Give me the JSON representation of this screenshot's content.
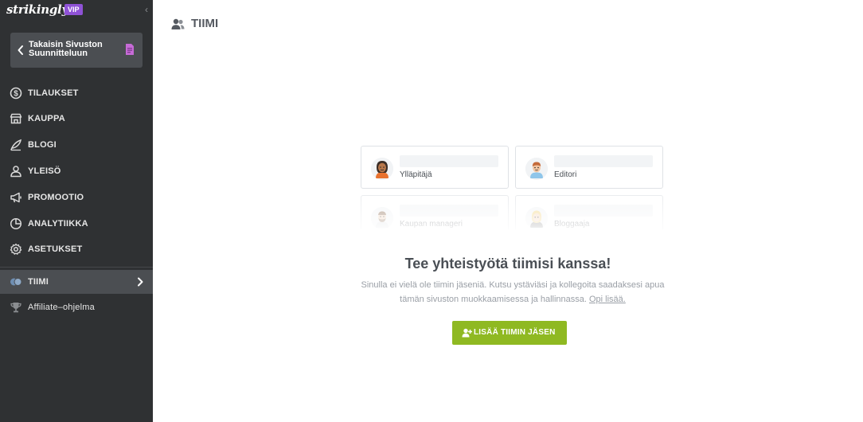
{
  "brand": {
    "logo": "strikingly",
    "badge": "VIP",
    "collapse_icon": "chevron-left-icon"
  },
  "sidebar": {
    "back_button": {
      "label": "Takaisin Sivuston Suunnitteluun",
      "icon": "chevron-left-icon",
      "file_icon": "document-icon",
      "file_icon_color": "#c66bd6"
    },
    "items": [
      {
        "label": "TILAUKSET",
        "icon": "dollar-circle-icon"
      },
      {
        "label": "KAUPPA",
        "icon": "store-icon"
      },
      {
        "label": "BLOGI",
        "icon": "quill-icon"
      },
      {
        "label": "YLEISÖ",
        "icon": "audience-icon"
      },
      {
        "label": "PROMOOTIO",
        "icon": "megaphone-icon"
      },
      {
        "label": "ANALYTIIKKA",
        "icon": "pie-chart-icon"
      },
      {
        "label": "ASETUKSET",
        "icon": "gear-icon"
      },
      {
        "label": "TIIMI",
        "icon": "team-icon",
        "active": true
      },
      {
        "label": "Affiliate–ohjelma",
        "icon": "trophy-icon"
      }
    ]
  },
  "main": {
    "title": "TIIMI",
    "title_icon": "team-icon",
    "roles": [
      "Ylläpitäjä",
      "Editori",
      "Kaupan manageri",
      "Bloggaaja"
    ],
    "headline": "Tee yhteistyötä tiimisi kanssa!",
    "description": "Sinulla ei vielä ole tiimin jäseniä. Kutsu ystäviäsi ja kollegoita saadaksesi apua tämän sivuston muokkaamisessa ja hallinnassa.",
    "learn_more": "Opi lisää.",
    "add_button": {
      "label": "LISÄÄ TIIMIN JÄSEN",
      "icon": "add-user-icon"
    }
  },
  "colors": {
    "sidebar_bg": "#2f3133",
    "active_bg": "#4b4e52",
    "accent_green": "#8fb922",
    "vip_purple": "#8f52d6"
  }
}
